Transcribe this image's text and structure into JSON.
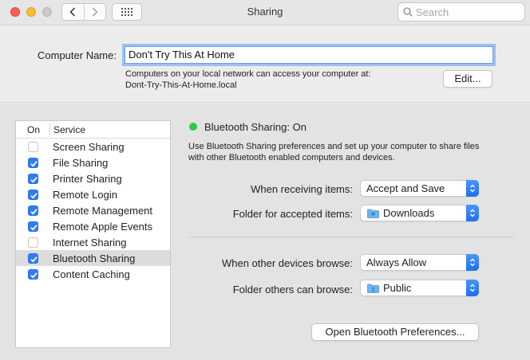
{
  "window": {
    "title": "Sharing",
    "search_placeholder": "Search",
    "colors": {
      "accent": "#2f7cf6",
      "status_on": "#2fc848"
    }
  },
  "computer_name": {
    "label": "Computer Name:",
    "value": "Don't Try This At Home",
    "note_line1": "Computers on your local network can access your computer at:",
    "note_line2": "Dont-Try-This-At-Home.local",
    "edit_label": "Edit..."
  },
  "services": {
    "header_on": "On",
    "header_service": "Service",
    "items": [
      {
        "name": "Screen Sharing",
        "on": false,
        "selected": false
      },
      {
        "name": "File Sharing",
        "on": true,
        "selected": false
      },
      {
        "name": "Printer Sharing",
        "on": true,
        "selected": false
      },
      {
        "name": "Remote Login",
        "on": true,
        "selected": false
      },
      {
        "name": "Remote Management",
        "on": true,
        "selected": false
      },
      {
        "name": "Remote Apple Events",
        "on": true,
        "selected": false
      },
      {
        "name": "Internet Sharing",
        "on": false,
        "selected": false
      },
      {
        "name": "Bluetooth Sharing",
        "on": true,
        "selected": true
      },
      {
        "name": "Content Caching",
        "on": true,
        "selected": false
      }
    ]
  },
  "detail": {
    "status": "Bluetooth Sharing: On",
    "description_line1": "Use Bluetooth Sharing preferences and set up your computer to share files",
    "description_line2": "with other Bluetooth enabled computers and devices.",
    "receiving_label": "When receiving items:",
    "receiving_value": "Accept and Save",
    "accepted_folder_label": "Folder for accepted items:",
    "accepted_folder_value": "Downloads",
    "browse_label": "When other devices browse:",
    "browse_value": "Always Allow",
    "browse_folder_label": "Folder others can browse:",
    "browse_folder_value": "Public",
    "open_button_label": "Open Bluetooth Preferences..."
  }
}
